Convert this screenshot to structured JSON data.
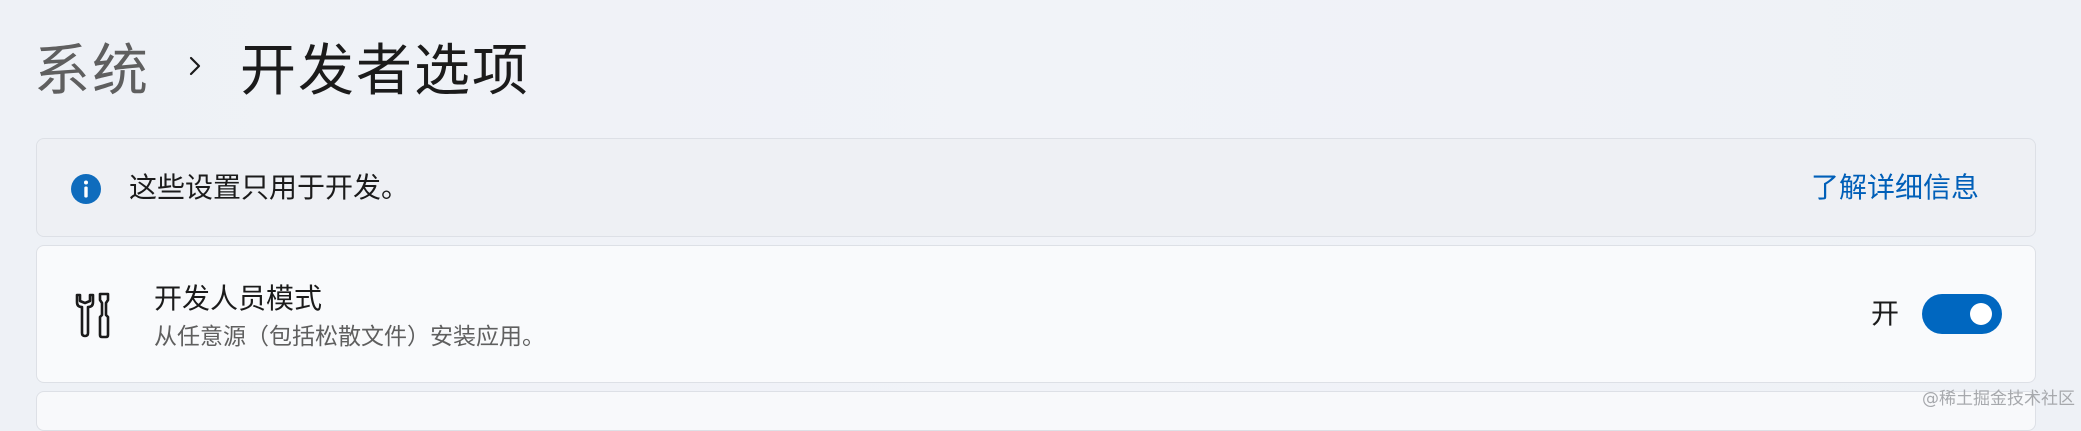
{
  "breadcrumb": {
    "parent": "系统",
    "current": "开发者选项"
  },
  "info_bar": {
    "icon": "info-icon",
    "text": "这些设置只用于开发。",
    "link": "了解详细信息"
  },
  "developer_mode": {
    "icon": "tools-icon",
    "title": "开发人员模式",
    "description": "从任意源（包括松散文件）安装应用。",
    "state_label": "开",
    "enabled": true
  },
  "watermark": "@稀土掘金技术社区",
  "colors": {
    "accent": "#0067c0",
    "link": "#005fb8",
    "info_icon": "#0f6cbd"
  }
}
